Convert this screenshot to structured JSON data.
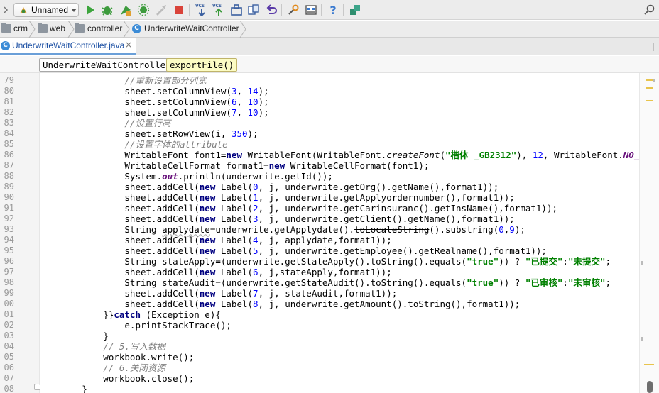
{
  "toolbar": {
    "run_config": "Unnamed",
    "icons": [
      "run-icon",
      "debug-icon",
      "run-coverage-icon",
      "profile-icon",
      "build-icon",
      "stop-icon",
      "vcs-update-icon",
      "vcs-commit-icon",
      "vcs-history-icon",
      "vcs-compare-icon",
      "undo-icon",
      "settings-icon",
      "project-structure-icon",
      "help-icon",
      "sdk-icon"
    ],
    "vcs_label": "VCS"
  },
  "breadcrumb": {
    "items": [
      "crm",
      "web",
      "controller",
      "UnderwriteWaitController"
    ]
  },
  "tabs": {
    "active_file": "UnderwriteWaitController.java",
    "close_glyph": "×"
  },
  "method_bar": {
    "class_name": "UnderwriteWaitController",
    "method_name": "exportFile()"
  },
  "editor": {
    "line_numbers": [
      "79",
      "80",
      "81",
      "82",
      "83",
      "84",
      "85",
      "86",
      "87",
      "88",
      "89",
      "90",
      "91",
      "92",
      "93",
      "94",
      "95",
      "96",
      "97",
      "98",
      "99",
      "00",
      "01",
      "02",
      "03",
      "04",
      "05",
      "06",
      "07",
      "08"
    ],
    "lines": [
      [
        {
          "t": "                //重新设置部分列宽",
          "c": "cm"
        }
      ],
      [
        {
          "t": "                sheet.setColumnView(",
          "c": ""
        },
        {
          "t": "3",
          "c": "num"
        },
        {
          "t": ", ",
          "c": ""
        },
        {
          "t": "14",
          "c": "num"
        },
        {
          "t": ");",
          "c": ""
        }
      ],
      [
        {
          "t": "                sheet.setColumnView(",
          "c": ""
        },
        {
          "t": "6",
          "c": "num"
        },
        {
          "t": ", ",
          "c": ""
        },
        {
          "t": "10",
          "c": "num"
        },
        {
          "t": ");",
          "c": ""
        }
      ],
      [
        {
          "t": "                sheet.setColumnView(",
          "c": ""
        },
        {
          "t": "7",
          "c": "num"
        },
        {
          "t": ", ",
          "c": ""
        },
        {
          "t": "10",
          "c": "num"
        },
        {
          "t": ");",
          "c": ""
        }
      ],
      [
        {
          "t": "                //设置行高",
          "c": "cm"
        }
      ],
      [
        {
          "t": "                sheet.setRowView(i, ",
          "c": ""
        },
        {
          "t": "350",
          "c": "num"
        },
        {
          "t": ");",
          "c": ""
        }
      ],
      [
        {
          "t": "                //设置字体的attribute",
          "c": "cm"
        }
      ],
      [
        {
          "t": "                WritableFont font1=",
          "c": ""
        },
        {
          "t": "new",
          "c": "kw"
        },
        {
          "t": " WritableFont(WritableFont.",
          "c": ""
        },
        {
          "t": "createFont",
          "c": "it"
        },
        {
          "t": "(",
          "c": ""
        },
        {
          "t": "\"楷体 _GB2312\"",
          "c": "str"
        },
        {
          "t": "), ",
          "c": ""
        },
        {
          "t": "12",
          "c": "num"
        },
        {
          "t": ", WritableFont.",
          "c": ""
        },
        {
          "t": "NO_BOLD",
          "c": "fld"
        },
        {
          "t": ");",
          "c": ""
        }
      ],
      [
        {
          "t": "                WritableCellFormat format1=",
          "c": ""
        },
        {
          "t": "new",
          "c": "kw"
        },
        {
          "t": " WritableCellFormat(font1);",
          "c": ""
        }
      ],
      [
        {
          "t": "                System.",
          "c": ""
        },
        {
          "t": "out",
          "c": "fld"
        },
        {
          "t": ".println(underwrite.getId());",
          "c": ""
        }
      ],
      [
        {
          "t": "                sheet.addCell(",
          "c": ""
        },
        {
          "t": "new",
          "c": "kw"
        },
        {
          "t": " Label(",
          "c": ""
        },
        {
          "t": "0",
          "c": "num"
        },
        {
          "t": ", j, underwrite.getOrg().getName(),format1));",
          "c": ""
        }
      ],
      [
        {
          "t": "                sheet.addCell(",
          "c": ""
        },
        {
          "t": "new",
          "c": "kw"
        },
        {
          "t": " Label(",
          "c": ""
        },
        {
          "t": "1",
          "c": "num"
        },
        {
          "t": ", j, underwrite.getApplyordernumber(),format1));",
          "c": ""
        }
      ],
      [
        {
          "t": "                sheet.addCell(",
          "c": ""
        },
        {
          "t": "new",
          "c": "kw"
        },
        {
          "t": " Label(",
          "c": ""
        },
        {
          "t": "2",
          "c": "num"
        },
        {
          "t": ", j, underwrite.getCarinsuranc().getInsName(),format1));",
          "c": ""
        }
      ],
      [
        {
          "t": "                sheet.addCell(",
          "c": ""
        },
        {
          "t": "new",
          "c": "kw"
        },
        {
          "t": " Label(",
          "c": ""
        },
        {
          "t": "3",
          "c": "num"
        },
        {
          "t": ", j, underwrite.getClient().getName(),format1));",
          "c": ""
        }
      ],
      [
        {
          "t": "                String ",
          "c": ""
        },
        {
          "t": "applydate",
          "c": "sw"
        },
        {
          "t": "=underwrite.getApplydate().",
          "c": ""
        },
        {
          "t": "toLocaleString",
          "c": "dep"
        },
        {
          "t": "().substring(",
          "c": ""
        },
        {
          "t": "0",
          "c": "num"
        },
        {
          "t": ",",
          "c": ""
        },
        {
          "t": "9",
          "c": "num"
        },
        {
          "t": ");",
          "c": ""
        }
      ],
      [
        {
          "t": "                sheet.addCell(",
          "c": ""
        },
        {
          "t": "new",
          "c": "kw"
        },
        {
          "t": " Label(",
          "c": ""
        },
        {
          "t": "4",
          "c": "num"
        },
        {
          "t": ", j, applydate,format1));",
          "c": ""
        }
      ],
      [
        {
          "t": "                sheet.addCell(",
          "c": ""
        },
        {
          "t": "new",
          "c": "kw"
        },
        {
          "t": " Label(",
          "c": ""
        },
        {
          "t": "5",
          "c": "num"
        },
        {
          "t": ", j, underwrite.getEmployee().getRealname(),format1));",
          "c": ""
        }
      ],
      [
        {
          "t": "                String stateApply=(underwrite.getStateApply().toString().equals(",
          "c": ""
        },
        {
          "t": "\"true\"",
          "c": "str"
        },
        {
          "t": ")) ? ",
          "c": ""
        },
        {
          "t": "\"已提交\"",
          "c": "str"
        },
        {
          "t": ":",
          "c": ""
        },
        {
          "t": "\"未提交\"",
          "c": "str"
        },
        {
          "t": ";",
          "c": ""
        }
      ],
      [
        {
          "t": "                sheet.addCell(",
          "c": ""
        },
        {
          "t": "new",
          "c": "kw"
        },
        {
          "t": " Label(",
          "c": ""
        },
        {
          "t": "6",
          "c": "num"
        },
        {
          "t": ", j,stateApply,format1));",
          "c": ""
        }
      ],
      [
        {
          "t": "                String stateAudit=(underwrite.getStateAudit().toString().equals(",
          "c": ""
        },
        {
          "t": "\"true\"",
          "c": "str"
        },
        {
          "t": ")) ? ",
          "c": ""
        },
        {
          "t": "\"已审核\"",
          "c": "str"
        },
        {
          "t": ":",
          "c": ""
        },
        {
          "t": "\"未审核\"",
          "c": "str"
        },
        {
          "t": ";",
          "c": ""
        }
      ],
      [
        {
          "t": "                sheet.addCell(",
          "c": ""
        },
        {
          "t": "new",
          "c": "kw"
        },
        {
          "t": " Label(",
          "c": ""
        },
        {
          "t": "7",
          "c": "num"
        },
        {
          "t": ", j, stateAudit,format1));",
          "c": ""
        }
      ],
      [
        {
          "t": "                sheet.addCell(",
          "c": ""
        },
        {
          "t": "new",
          "c": "kw"
        },
        {
          "t": " Label(",
          "c": ""
        },
        {
          "t": "8",
          "c": "num"
        },
        {
          "t": ", j, underwrite.getAmount().toString(),format1));",
          "c": ""
        }
      ],
      [
        {
          "t": "            }}",
          "c": ""
        },
        {
          "t": "catch",
          "c": "kw"
        },
        {
          "t": " (Exception e){",
          "c": ""
        }
      ],
      [
        {
          "t": "                e.printStackTrace();",
          "c": ""
        }
      ],
      [
        {
          "t": "            }",
          "c": ""
        }
      ],
      [
        {
          "t": "            // 5.写入数据",
          "c": "cm"
        }
      ],
      [
        {
          "t": "            workbook.write();",
          "c": ""
        }
      ],
      [
        {
          "t": "            // 6.关闭资源",
          "c": "cm"
        }
      ],
      [
        {
          "t": "            workbook.close();",
          "c": ""
        }
      ],
      [
        {
          "t": "        }",
          "c": ""
        }
      ]
    ]
  },
  "colors": {
    "keyword": "#000080",
    "string": "#008000",
    "number": "#0000ff",
    "comment": "#808080",
    "static_field": "#660e7a",
    "tab_accent": "#6a9fd8",
    "highlight_box": "#fcfcc4"
  }
}
